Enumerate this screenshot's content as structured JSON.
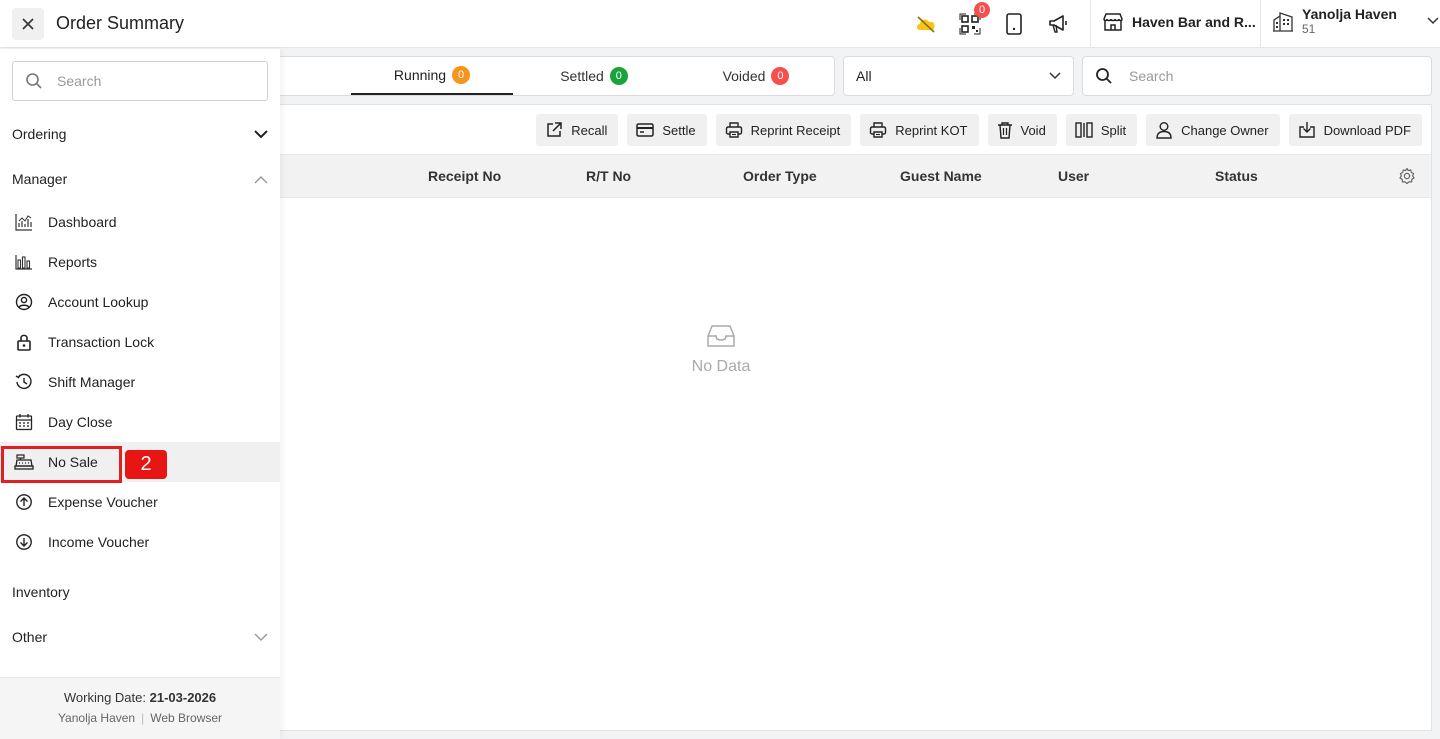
{
  "header": {
    "title": "Order Summary",
    "notification_count": "0",
    "store_name": "Haven Bar and R...",
    "org_name": "Yanolja Haven",
    "org_id": "51",
    "colors": {
      "weather_icon": "#f5c518",
      "badge": "#f5504d"
    }
  },
  "sidebar": {
    "search_placeholder": "Search",
    "sections": {
      "ordering": "Ordering",
      "manager": "Manager",
      "inventory": "Inventory",
      "other": "Other"
    },
    "manager_items": [
      {
        "label": "Dashboard",
        "icon": "chart-line-icon"
      },
      {
        "label": "Reports",
        "icon": "bar-chart-icon"
      },
      {
        "label": "Account Lookup",
        "icon": "user-circle-icon"
      },
      {
        "label": "Transaction Lock",
        "icon": "lock-icon"
      },
      {
        "label": "Shift Manager",
        "icon": "clock-rotate-icon"
      },
      {
        "label": "Day Close",
        "icon": "calendar-icon"
      },
      {
        "label": "No Sale",
        "icon": "cash-register-icon"
      },
      {
        "label": "Expense Voucher",
        "icon": "arrow-up-circle-icon"
      },
      {
        "label": "Income Voucher",
        "icon": "arrow-down-circle-icon"
      }
    ],
    "annotation_number": "2",
    "footer": {
      "working_date_label": "Working Date:",
      "working_date": "21-03-2026",
      "org": "Yanolja Haven",
      "sep": "|",
      "platform": "Web Browser"
    }
  },
  "main": {
    "tabs": [
      {
        "label": "Running",
        "count": "0",
        "color": "#f7941d"
      },
      {
        "label": "Settled",
        "count": "0",
        "color": "#1aa33b"
      },
      {
        "label": "Voided",
        "count": "0",
        "color": "#f5504d"
      }
    ],
    "filter_value": "All",
    "search_placeholder": "Search",
    "toolbar": [
      "Recall",
      "Settle",
      "Reprint Receipt",
      "Reprint KOT",
      "Void",
      "Split",
      "Change Owner",
      "Download PDF"
    ],
    "columns": [
      "Receipt No",
      "R/T No",
      "Order Type",
      "Guest Name",
      "User",
      "Status"
    ],
    "empty_text": "No Data"
  }
}
